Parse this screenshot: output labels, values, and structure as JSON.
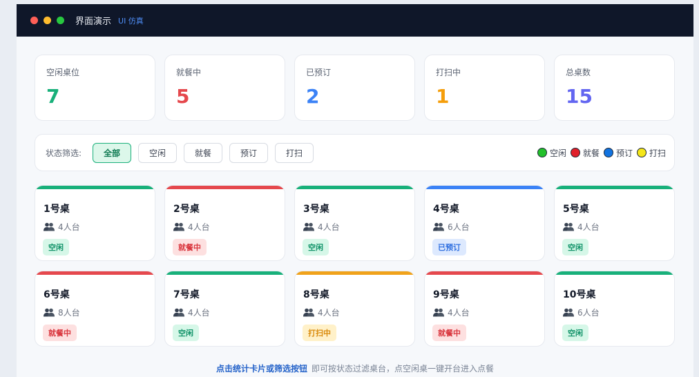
{
  "window": {
    "title": "界面演示",
    "subtitle": "UI 仿真"
  },
  "stats": [
    {
      "label": "空闲桌位",
      "value": "7",
      "color": "#18b07a"
    },
    {
      "label": "就餐中",
      "value": "5",
      "color": "#e5484d"
    },
    {
      "label": "已预订",
      "value": "2",
      "color": "#3b82f6"
    },
    {
      "label": "打扫中",
      "value": "1",
      "color": "#f59e0b"
    },
    {
      "label": "总桌数",
      "value": "15",
      "color": "#6366f1"
    }
  ],
  "filter": {
    "label": "状态筛选:",
    "buttons": [
      "全部",
      "空闲",
      "就餐",
      "预订",
      "打扫"
    ],
    "active": "全部"
  },
  "legend": [
    {
      "label": "空闲",
      "color": "#22c02a"
    },
    {
      "label": "就餐",
      "color": "#e0202a"
    },
    {
      "label": "预订",
      "color": "#1273e0"
    },
    {
      "label": "打扫",
      "color": "#f5e619"
    }
  ],
  "status_styles": {
    "空闲": {
      "bar": "#18b07a",
      "bg": "#d6f7e8",
      "fg": "#13946a"
    },
    "就餐中": {
      "bar": "#e5484d",
      "bg": "#fde0e0",
      "fg": "#d9363e"
    },
    "已预订": {
      "bar": "#3b82f6",
      "bg": "#dde9fe",
      "fg": "#2f6fe0"
    },
    "打扫中": {
      "bar": "#f0a21a",
      "bg": "#fff1c9",
      "fg": "#d98a0b"
    }
  },
  "tables": [
    {
      "name": "1号桌",
      "seats": "4人台",
      "status": "空闲"
    },
    {
      "name": "2号桌",
      "seats": "4人台",
      "status": "就餐中"
    },
    {
      "name": "3号桌",
      "seats": "4人台",
      "status": "空闲"
    },
    {
      "name": "4号桌",
      "seats": "6人台",
      "status": "已预订"
    },
    {
      "name": "5号桌",
      "seats": "4人台",
      "status": "空闲"
    },
    {
      "name": "6号桌",
      "seats": "8人台",
      "status": "就餐中"
    },
    {
      "name": "7号桌",
      "seats": "4人台",
      "status": "空闲"
    },
    {
      "name": "8号桌",
      "seats": "4人台",
      "status": "打扫中"
    },
    {
      "name": "9号桌",
      "seats": "4人台",
      "status": "就餐中"
    },
    {
      "name": "10号桌",
      "seats": "6人台",
      "status": "空闲"
    }
  ],
  "hint": {
    "strong": "点击统计卡片或筛选按钮",
    "text": "即可按状态过滤桌台，点空闲桌一键开台进入点餐"
  }
}
